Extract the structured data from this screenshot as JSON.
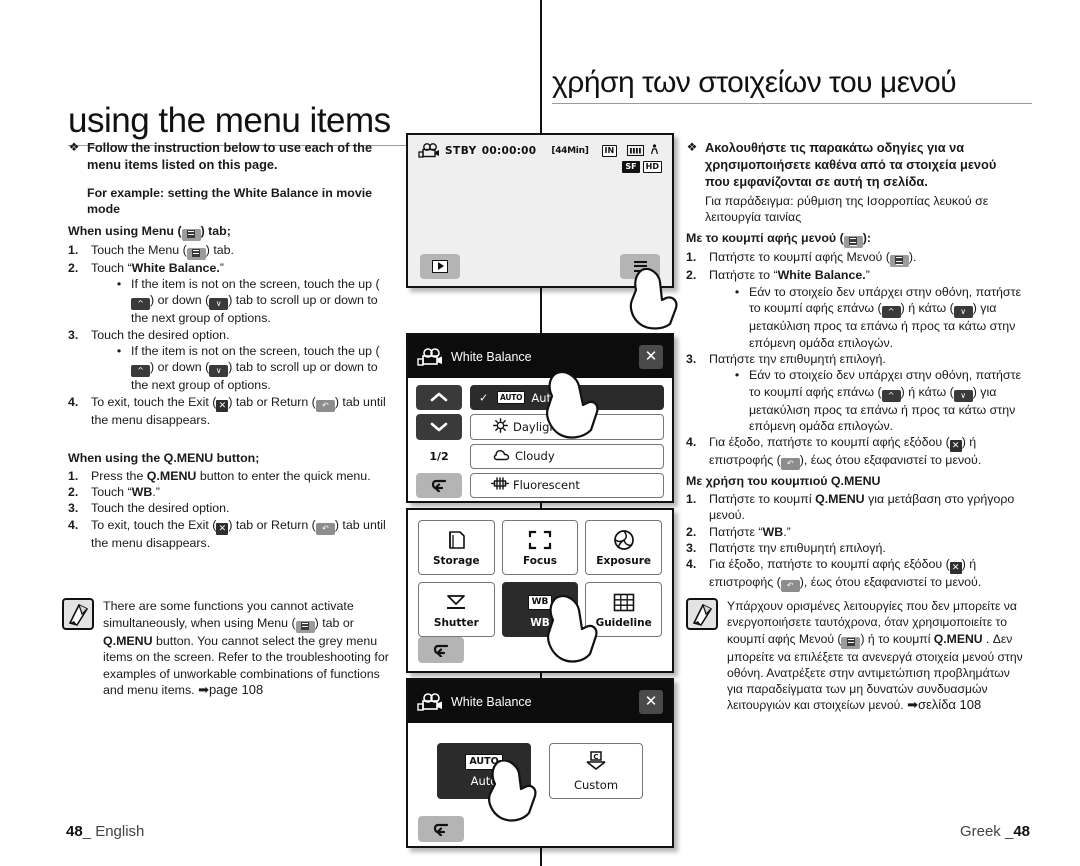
{
  "left": {
    "heading": "using the menu items",
    "intro_bullet": "Follow the instruction below to use each of the menu items listed on this page.",
    "example_note": "For example: setting the White Balance in movie mode",
    "menu_section_title_pre": "When using Menu (",
    "menu_section_title_post": ") tab;",
    "steps_menu": [
      {
        "num": "1.",
        "pre": "Touch the Menu (",
        "post": ") tab."
      },
      {
        "num": "2.",
        "pre": "Touch “",
        "bold": "White Balance.",
        "post": "”"
      },
      {
        "num": "3.",
        "pre": "Touch the desired option."
      },
      {
        "num": "4.",
        "pre": "To exit, touch the Exit (",
        "mid": ") tab or Return (",
        "post": ") tab until the menu disappears."
      }
    ],
    "sub_bullet_scroll": {
      "part1": "If the item is not on the screen, touch the up (",
      "part2": ") or down (",
      "part3": ") tab to scroll up or down to the next group of options."
    },
    "qmenu_section_title": "When using the Q.MENU button;",
    "steps_qmenu": [
      {
        "num": "1.",
        "pre": "Press the ",
        "bold": "Q.MENU",
        "post": " button to enter the quick menu."
      },
      {
        "num": "2.",
        "pre": "Touch “",
        "bold": "WB",
        "post": ".”"
      },
      {
        "num": "3.",
        "pre": "Touch the desired option."
      },
      {
        "num": "4.",
        "pre": "To exit, touch the Exit (",
        "mid": ") tab or Return (",
        "post": ") tab until the menu disappears."
      }
    ],
    "note": {
      "part1": "There are some functions you cannot activate simultaneously, when using Menu (",
      "part2": ") tab or ",
      "bold": "Q.MENU",
      "part3": " button. You cannot select the grey menu items on the screen. Refer to the troubleshooting for examples of unworkable combinations of functions and menu items.",
      "page_ref": "➡page 108"
    },
    "footer_num": "48",
    "footer_lang": "English"
  },
  "right": {
    "heading": "χρήση των στοιχείων του μενού",
    "intro_bullet": "Ακολουθήστε τις παρακάτω οδηγίες για να χρησιμοποιήσετε καθένα από τα στοιχεία μενού που εμφανίζονται σε αυτή τη σελίδα.",
    "example_note": "Για παράδειγμα: ρύθμιση της Ισορροπίας λευκού σε λειτουργία ταινίας",
    "menu_section_title_pre": "Με το κουμπί αφής μενού (",
    "menu_section_title_post": "):",
    "steps_menu": [
      {
        "num": "1.",
        "pre": "Πατήστε το κουμπί αφής Μενού (",
        "post": ")."
      },
      {
        "num": "2.",
        "pre": "Πατήστε το “",
        "bold": "White Balance.",
        "post": "”"
      },
      {
        "num": "3.",
        "pre": "Πατήστε την επιθυμητή επιλογή."
      },
      {
        "num": "4.",
        "pre": "Για έξοδο, πατήστε το κουμπί αφής εξόδου (",
        "mid": ") ή επιστροφής (",
        "post": "), έως ότου εξαφανιστεί το μενού."
      }
    ],
    "sub_bullet_scroll": {
      "part1": "Εάν το στοιχείο δεν υπάρχει στην οθόνη, πατήστε το κουμπί αφής επάνω (",
      "part2": ") ή κάτω (",
      "part3": ") για μετακύλιση προς τα επάνω ή προς τα κάτω στην επόμενη ομάδα επιλογών."
    },
    "qmenu_section_title": "Με χρήση του κουμπιού Q.MENU",
    "steps_qmenu": [
      {
        "num": "1.",
        "pre": "Πατήστε το κουμπί ",
        "bold": "Q.MENU",
        "post": " για μετάβαση στο γρήγορο μενού."
      },
      {
        "num": "2.",
        "pre": "Πατήστε “",
        "bold": "WB",
        "post": ".”"
      },
      {
        "num": "3.",
        "pre": "Πατήστε την επιθυμητή επιλογή."
      },
      {
        "num": "4.",
        "pre": "Για έξοδο, πατήστε το κουμπί αφής εξόδου (",
        "mid": ") ή επιστροφής (",
        "post": "), έως ότου εξαφανιστεί το μενού."
      }
    ],
    "note": {
      "part1": "Υπάρχουν ορισμένες λειτουργίες που δεν μπορείτε να ενεργοποιήσετε ταυτόχρονα, όταν χρησιμοποιείτε το κουμπί αφής Μενού (",
      "part2": ") ή το κουμπί ",
      "bold": "Q.MENU",
      "part3": " . Δεν μπορείτε να επιλέξετε τα ανενεργά στοιχεία μενού στην οθόνη. Ανατρέξετε στην αντιμετώπιση προβλημάτων για παραδείγματα των μη δυνατών συνδυασμών λειτουργιών και στοιχείων μενού.",
      "page_ref": "➡σελίδα 108"
    },
    "footer_num": "48",
    "footer_lang": "Greek"
  },
  "lcd_recording": {
    "mode_icon": "movie-camera-icon",
    "status": "STBY",
    "timecode": "00:00:00",
    "remaining": "[44Min]",
    "storage_badge": "IN",
    "battery_icon": "battery-icon",
    "quality_badge": "SF",
    "resolution_badge": "HD",
    "play_tab": "play-tab",
    "menu_tab": "menu-tab"
  },
  "lcd_white_balance_list": {
    "title": "White Balance",
    "close_label": "✕",
    "page_indicator": "1/2",
    "up_label": "ⱏ",
    "down_label": "ⱟ",
    "return_label": "↩",
    "items": [
      {
        "label": "Auto",
        "icon": "auto-chip-icon",
        "selected": true,
        "checked": true
      },
      {
        "label": "Daylight",
        "icon": "sun-icon",
        "selected": false,
        "checked": false
      },
      {
        "label": "Cloudy",
        "icon": "cloud-icon",
        "selected": false,
        "checked": false
      },
      {
        "label": "Fluorescent",
        "icon": "fluorescent-icon",
        "selected": false,
        "checked": false
      }
    ]
  },
  "lcd_quick_menu": {
    "return_label": "↩",
    "cells": [
      {
        "label": "Storage",
        "icon": "memory-card-icon",
        "selected": false
      },
      {
        "label": "Focus",
        "icon": "focus-brackets-icon",
        "selected": false
      },
      {
        "label": "Exposure",
        "icon": "aperture-icon",
        "selected": false
      },
      {
        "label": "Shutter",
        "icon": "shutter-icon",
        "selected": false
      },
      {
        "label": "WB",
        "icon": "wb-chip-icon",
        "selected": true
      },
      {
        "label": "Guideline",
        "icon": "grid-icon",
        "selected": false
      }
    ]
  },
  "lcd_white_balance_options": {
    "title": "White Balance",
    "close_label": "✕",
    "return_label": "↩",
    "options": [
      {
        "label": "Auto",
        "icon": "auto-chip-icon",
        "selected": true
      },
      {
        "label": "Custom",
        "icon": "custom-wb-icon",
        "selected": false
      }
    ]
  }
}
